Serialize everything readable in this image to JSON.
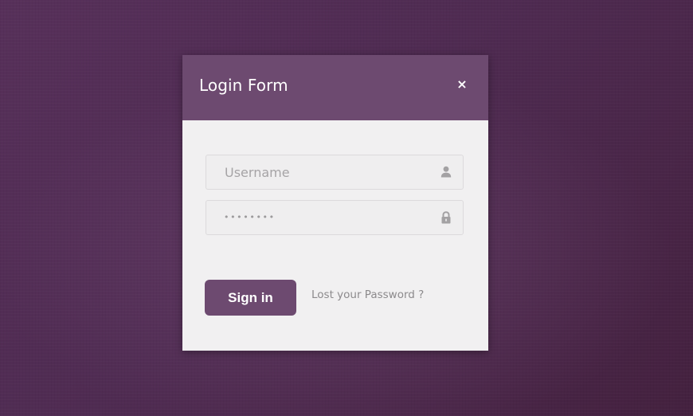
{
  "modal": {
    "title": "Login Form",
    "close_label": "×"
  },
  "form": {
    "username": {
      "placeholder": "Username",
      "value": "",
      "icon": "user-icon"
    },
    "password": {
      "masked_value": "••••••••",
      "icon": "lock-icon"
    },
    "signin_label": "Sign in",
    "forgot_label": "Lost your Password ?"
  },
  "colors": {
    "background": "#4f2b52",
    "accent": "#6d4a70",
    "panel": "#f1f0f1",
    "muted_text": "#8c8a8c"
  }
}
